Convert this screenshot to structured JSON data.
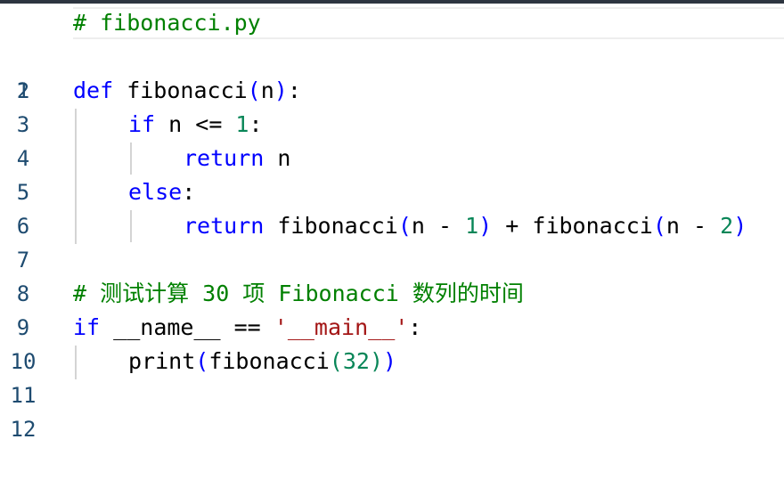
{
  "editor": {
    "line_numbers": [
      "1",
      "2",
      "3",
      "4",
      "5",
      "6",
      "7",
      "8",
      "9",
      "10",
      "11",
      "12"
    ],
    "lines": {
      "l1": {
        "comment": "# fibonacci.py"
      },
      "l3": {
        "kw_def": "def",
        "name": " fibonacci",
        "paren_open": "(",
        "param": "n",
        "paren_close": ")",
        "colon": ":"
      },
      "l4": {
        "kw_if": "if",
        "cond": " n <= ",
        "num": "1",
        "colon": ":"
      },
      "l5": {
        "kw_return": "return",
        "rest": " n"
      },
      "l6": {
        "kw_else": "else",
        "colon": ":"
      },
      "l7": {
        "kw_return": "return",
        "call1": " fibonacci",
        "p1o": "(",
        "arg1": "n - ",
        "num1": "1",
        "p1c": ")",
        "plus": " + fibonacci",
        "p2o": "(",
        "arg2": "n - ",
        "num2": "2",
        "p2c": ")"
      },
      "l9": {
        "comment": "# 测试计算 30 项 Fibonacci 数列的时间"
      },
      "l10": {
        "kw_if": "if",
        "mid": " __name__ == ",
        "str": "'__main__'",
        "colon": ":"
      },
      "l11": {
        "fn": "print",
        "po": "(",
        "call": "fibonacci",
        "pio": "(",
        "num": "32",
        "pic": ")",
        "pc": ")"
      }
    }
  },
  "colors": {
    "keyword": "#0000ff",
    "comment": "#008000",
    "number": "#098658",
    "string": "#a31515",
    "line_number": "#1e4b70"
  }
}
